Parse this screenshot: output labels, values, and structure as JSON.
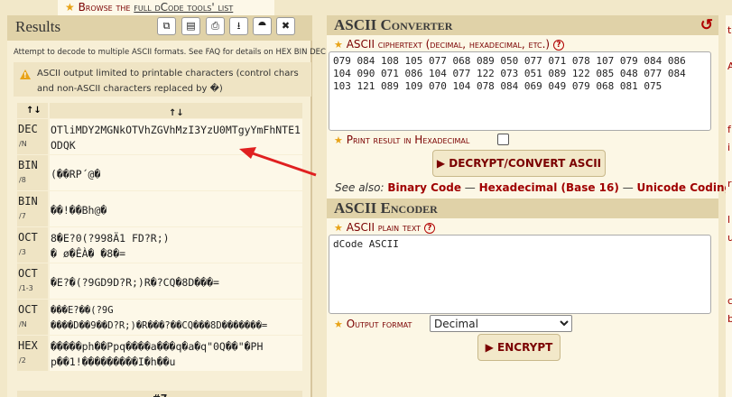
{
  "topbar": {
    "prefix": "★ ",
    "text1": "Browse the ",
    "link": "full dCode tools' list"
  },
  "results": {
    "title": "Results",
    "toolbar": [
      "⧉",
      "▤",
      "⎙",
      "⭳",
      "⯊",
      "✖"
    ],
    "note": "Attempt to decode to multiple ASCII formats. See FAQ for details on HEX BIN DEC",
    "warning": "ASCII output limited to printable characters (control chars and non-ASCII characters replaced by �)",
    "header": {
      "col1": "↑↓",
      "col2": "↑↓"
    },
    "rows": [
      {
        "label": "DEC",
        "sub": "/N",
        "value": "OTliMDY2MGNkOTVhZGVhMzI3YzU0MTgyYmFhNTE1ODQK"
      },
      {
        "label": "BIN",
        "sub": "/8",
        "value": "(��RP´@�"
      },
      {
        "label": "BIN",
        "sub": "/7",
        "value": "��!��Bh@�"
      },
      {
        "label": "OCT",
        "sub": "/3",
        "value": "8�E?0(?998Ä1 FD?R;)\n� ø�ÊÀ� �8�="
      },
      {
        "label": "OCT",
        "sub": "/1-3",
        "value": "�E?�(?9GD9D?R;)R�?CQ�8D���="
      },
      {
        "label": "OCT",
        "sub": "/N",
        "value": "���E?��(?9G\n����D��9��D?R;)�R���?��CQ���8D�������="
      },
      {
        "label": "HEX",
        "sub": "/2",
        "value": "�����ph��Ppq����a���q�a�q\"0Q��\"�PH\np��1!���������I�h��u"
      }
    ],
    "footer": "#7"
  },
  "converter": {
    "title": "ASCII Converter",
    "cipher_label": "ASCII ciphertext (decimal, hexadecimal, etc.)",
    "cipher_value": "079 084 108 105 077 068 089 050 077 071 078 107 079 084 086\n104 090 071 086 104 077 122 073 051 089 122 085 048 077 084\n103 121 089 109 070 104 078 084 069 049 079 068 081 075",
    "hex_label": "Print result in Hexadecimal",
    "decrypt_button": "▶ DECRYPT/CONVERT ASCII",
    "see_also_label": "See also:",
    "see_also_links": [
      "Binary Code",
      "Hexadecimal (Base 16)",
      "Unicode Coding"
    ],
    "separator": "—"
  },
  "encoder": {
    "title": "ASCII Encoder",
    "plain_label": "ASCII plain text",
    "plain_value": "dCode ASCII",
    "format_label": "Output format",
    "format_selected": "Decimal",
    "encrypt_button": "▶ ENCRYPT"
  },
  "colors": {
    "accent": "#7a0000",
    "star": "#e8a317",
    "arrow": "#e02020"
  }
}
